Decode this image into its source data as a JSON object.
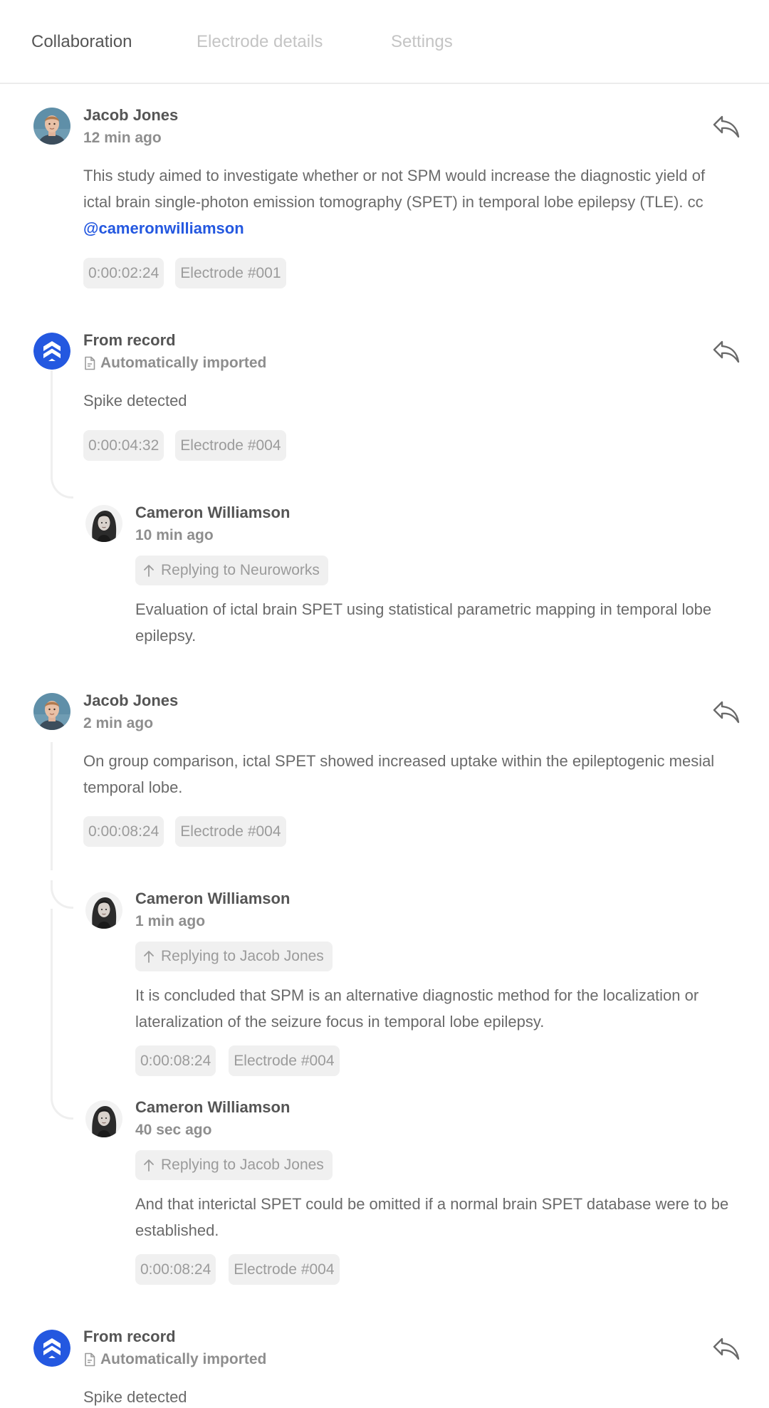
{
  "tabs": [
    {
      "label": "Collaboration",
      "active": true
    },
    {
      "label": "Electrode details",
      "active": false
    },
    {
      "label": "Settings",
      "active": false
    }
  ],
  "colors": {
    "accent": "#2458e0",
    "text": "#555555",
    "muted": "#9b9b9b",
    "chip_bg": "#f0f0f0"
  },
  "comments": [
    {
      "author": "Jacob Jones",
      "time": "12 min ago",
      "text_before": "This study aimed to investigate whether or not SPM would increase the diagnostic yield of ictal brain single-photon emission tomography (SPET) in temporal lobe epilepsy (TLE). cc ",
      "mention": "@cameronwilliamson",
      "chips": [
        "0:00:02:24",
        "Electrode #001"
      ],
      "icon": "reply-icon"
    },
    {
      "author": "From record",
      "subtitle": "Automatically imported",
      "text": "Spike detected",
      "chips": [
        "0:00:04:32",
        "Electrode #004"
      ],
      "icon": "reply-icon",
      "replies": [
        {
          "author": "Cameron Williamson",
          "time": "10 min ago",
          "replying_to": "Replying to Neuroworks",
          "text": "Evaluation of ictal brain SPET using statistical parametric mapping in temporal lobe epilepsy."
        }
      ]
    },
    {
      "author": "Jacob Jones",
      "time": "2 min ago",
      "text": "On group comparison, ictal SPET showed increased uptake within the epileptogenic mesial temporal lobe.",
      "chips": [
        "0:00:08:24",
        "Electrode #004"
      ],
      "icon": "reply-icon",
      "replies": [
        {
          "author": "Cameron Williamson",
          "time": "1 min ago",
          "replying_to": "Replying to Jacob Jones",
          "text": "It is concluded that SPM is an alternative diagnostic method for the localization or lateralization of the seizure focus in temporal lobe epilepsy.",
          "chips": [
            "0:00:08:24",
            "Electrode #004"
          ]
        },
        {
          "author": "Cameron Williamson",
          "time": "40 sec ago",
          "replying_to": "Replying to Jacob Jones",
          "text": "And that interictal SPET could be omitted if a normal brain SPET database were to be established.",
          "chips": [
            "0:00:08:24",
            "Electrode #004"
          ]
        }
      ]
    },
    {
      "author": "From record",
      "subtitle": "Automatically imported",
      "text": "Spike detected",
      "icon": "reply-icon"
    }
  ]
}
